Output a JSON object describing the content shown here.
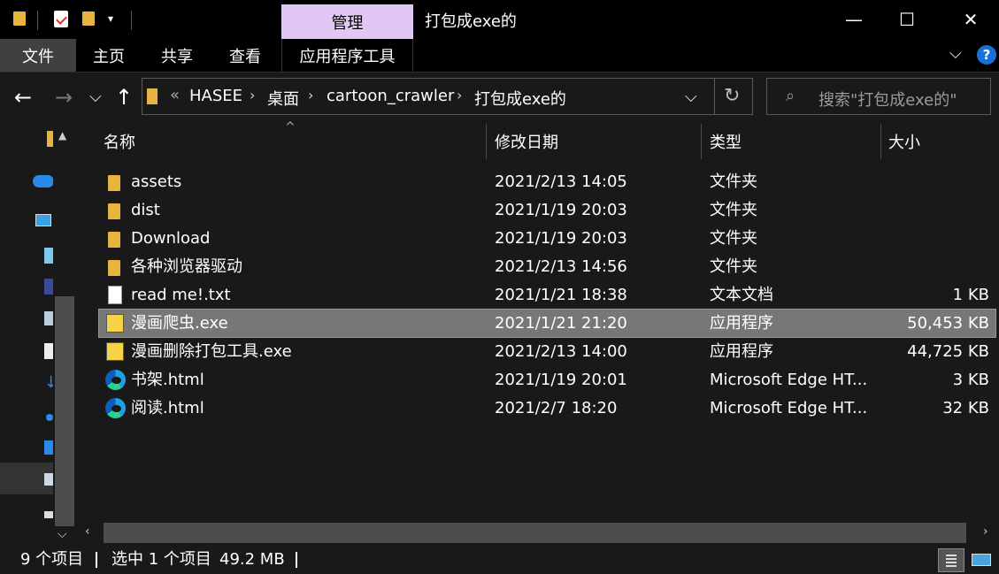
{
  "window": {
    "title": "打包成exe的",
    "manage_tab": "管理",
    "controls": {
      "minimize": "—",
      "maximize": "☐",
      "close": "✕"
    }
  },
  "ribbon": {
    "tabs": [
      "文件",
      "主页",
      "共享",
      "查看",
      "应用程序工具"
    ],
    "help": "?"
  },
  "address": {
    "overflow": "«",
    "crumbs": [
      "HASEE",
      "桌面",
      "cartoon_crawler",
      "打包成exe的"
    ]
  },
  "search": {
    "placeholder": "搜索\"打包成exe的\""
  },
  "columns": {
    "name": "名称",
    "date": "修改日期",
    "type": "类型",
    "size": "大小"
  },
  "files": [
    {
      "icon": "folder-icon",
      "name": "assets",
      "date": "2021/2/13 14:05",
      "type": "文件夹",
      "size": ""
    },
    {
      "icon": "folder-icon",
      "name": "dist",
      "date": "2021/1/19 20:03",
      "type": "文件夹",
      "size": ""
    },
    {
      "icon": "folder-icon",
      "name": "Download",
      "date": "2021/1/19 20:03",
      "type": "文件夹",
      "size": ""
    },
    {
      "icon": "folder-icon",
      "name": "各种浏览器驱动",
      "date": "2021/2/13 14:56",
      "type": "文件夹",
      "size": ""
    },
    {
      "icon": "text-file-icon",
      "name": "read me!.txt",
      "date": "2021/1/21 18:38",
      "type": "文本文档",
      "size": "1 KB"
    },
    {
      "icon": "python-exe-icon",
      "name": "漫画爬虫.exe",
      "date": "2021/1/21 21:20",
      "type": "应用程序",
      "size": "50,453 KB",
      "selected": true
    },
    {
      "icon": "python-exe-icon",
      "name": "漫画删除打包工具.exe",
      "date": "2021/2/13 14:00",
      "type": "应用程序",
      "size": "44,725 KB"
    },
    {
      "icon": "edge-icon",
      "name": "书架.html",
      "date": "2021/1/19 20:01",
      "type": "Microsoft Edge HT...",
      "size": "3 KB"
    },
    {
      "icon": "edge-icon",
      "name": "阅读.html",
      "date": "2021/2/7 18:20",
      "type": "Microsoft Edge HT...",
      "size": "32 KB"
    }
  ],
  "status": {
    "count": "9 个项目",
    "selection": "选中 1 个项目",
    "size": "49.2 MB"
  }
}
